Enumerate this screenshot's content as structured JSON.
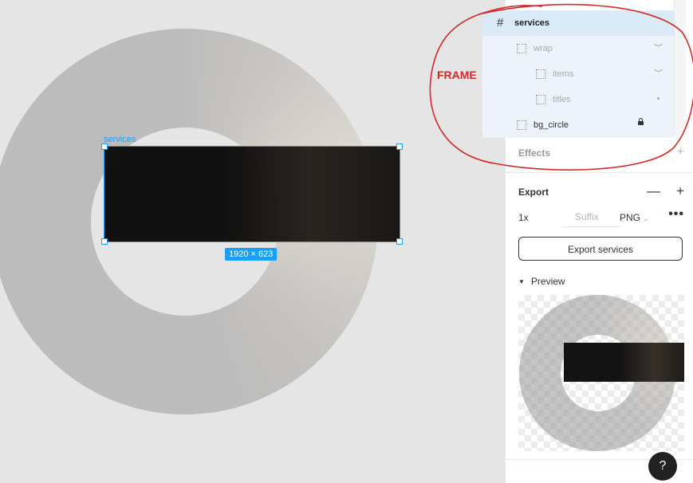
{
  "canvas": {
    "frame_label": "services",
    "size_badge": "1920 × 623"
  },
  "annotation": {
    "text": "FRAME",
    "color": "#d22a2a"
  },
  "layers": [
    {
      "name": "services",
      "icon": "frame-hash-icon",
      "selected": true
    },
    {
      "name": "wrap",
      "icon": "group-icon",
      "state": "hidden-eye-icon"
    },
    {
      "name": "items",
      "icon": "group-icon",
      "state": "hidden-eye-icon"
    },
    {
      "name": "titles",
      "icon": "group-icon",
      "state": "dot"
    },
    {
      "name": "bg_circle",
      "icon": "group-icon",
      "state": "lock-icon"
    }
  ],
  "panel": {
    "effects_label": "Effects",
    "export_label": "Export",
    "export_scale": "1x",
    "suffix_placeholder": "Suffix",
    "export_format": "PNG",
    "export_button": "Export services",
    "preview_label": "Preview",
    "help": "?"
  },
  "colors": {
    "selection": "#18a0fb",
    "layer_selected_bg": "#daebf7",
    "canvas_bg": "#e5e5e5"
  }
}
